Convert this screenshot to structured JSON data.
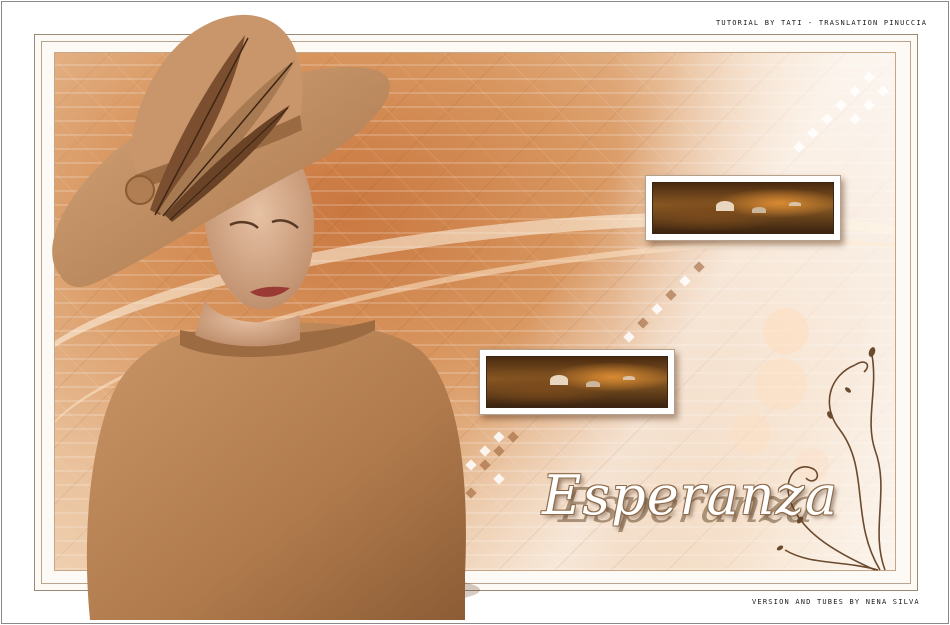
{
  "credits": {
    "tutorial": "TUTORIAL BY TATI - TRASNLATION PINUCCIA",
    "version": "VERSION AND TUBES BY NENA SILVA"
  },
  "artwork": {
    "title": "Esperanza",
    "palette": {
      "frame_border": "#9a8a78",
      "background_warm": "#d8955e",
      "background_light": "#f4ddc4",
      "hat_felt": "#c28d5e",
      "dress": "#b98558",
      "accent_white": "#ffffff"
    },
    "thumbnails": [
      "autumn-forest-mushroom-scene",
      "autumn-forest-mushroom-scene"
    ]
  }
}
